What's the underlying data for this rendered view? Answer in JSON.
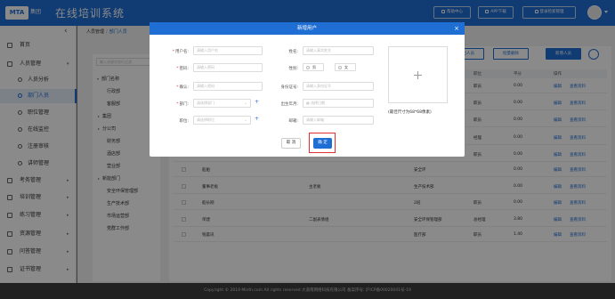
{
  "header": {
    "logo_text": "MTA",
    "logo_sub": "集团",
    "app_title": "在线培训系统",
    "buttons": [
      "帮助中心",
      "APP下载",
      "登录检索管理"
    ]
  },
  "sidebar": {
    "collapse_icon": "‹",
    "items": [
      {
        "label": "首页",
        "icon": "home-icon",
        "arrow": ""
      },
      {
        "label": "人员管理",
        "icon": "users-icon",
        "arrow": "▾"
      },
      {
        "label": "考务管理",
        "icon": "exam-icon",
        "arrow": "▸"
      },
      {
        "label": "培训管理",
        "icon": "training-icon",
        "arrow": "▸"
      },
      {
        "label": "练习管理",
        "icon": "practice-icon",
        "arrow": "▸"
      },
      {
        "label": "资源管理",
        "icon": "resource-icon",
        "arrow": "▸"
      },
      {
        "label": "问答管理",
        "icon": "qa-icon",
        "arrow": "▸"
      },
      {
        "label": "证书管理",
        "icon": "cert-icon",
        "arrow": "▸"
      }
    ],
    "sub_items": [
      "人员分析",
      "部门人员",
      "职位管理",
      "在线监控",
      "注册审核",
      "讲师管理"
    ],
    "active_sub": "部门人员"
  },
  "breadcrumb": {
    "root": "人员管理",
    "current": "部门人员"
  },
  "dept_tree": {
    "search_placeholder": "输入关键字进行过滤",
    "nodes": [
      {
        "label": "部门名称",
        "toggle": "▾",
        "indent": 0
      },
      {
        "label": "行政部",
        "toggle": "",
        "indent": 1
      },
      {
        "label": "客服部",
        "toggle": "",
        "indent": 1
      },
      {
        "label": "集团",
        "toggle": "▸",
        "indent": 1
      },
      {
        "label": "分公司",
        "toggle": "▸",
        "indent": 1
      },
      {
        "label": "财务部",
        "toggle": "",
        "indent": 1
      },
      {
        "label": "酒店部",
        "toggle": "",
        "indent": 1
      },
      {
        "label": "营业部",
        "toggle": "",
        "indent": 1
      },
      {
        "label": "新能部门",
        "toggle": "▸",
        "indent": 1
      },
      {
        "label": "安全环保管理部",
        "toggle": "",
        "indent": 1
      },
      {
        "label": "生产技术部",
        "toggle": "",
        "indent": 1
      },
      {
        "label": "市场运营部",
        "toggle": "",
        "indent": 1
      },
      {
        "label": "党群工作部",
        "toggle": "",
        "indent": 1
      }
    ]
  },
  "table": {
    "buttons": [
      "导出人员",
      "批量删除",
      "新增人员"
    ],
    "headers": [
      "职位",
      "平分",
      "操作"
    ],
    "rows": [
      {
        "c1": "",
        "c2": "",
        "c3": "",
        "status": "职员",
        "score": "0.00"
      },
      {
        "c1": "",
        "c2": "",
        "c3": "",
        "status": "职员",
        "score": "0.00"
      },
      {
        "c1": "",
        "c2": "",
        "c3": "",
        "status": "职员",
        "score": "0.00"
      },
      {
        "c1": "",
        "c2": "",
        "c3": "",
        "status": "经理",
        "score": "0.00"
      },
      {
        "c1": "",
        "c2": "",
        "c3": "",
        "status": "职员",
        "score": "0.00"
      },
      {
        "c1": "船舶",
        "c2": "",
        "c3": "安全环",
        "status": "",
        "score": "0.00"
      },
      {
        "c1": "董事老板",
        "c2": "主老板",
        "c3": "生产技术部",
        "status": "",
        "score": "0.00"
      },
      {
        "c1": "船长刚",
        "c2": "",
        "c3": "2班",
        "status": "职员",
        "score": "0.00"
      },
      {
        "c1": "单建",
        "c2": "二副表情组",
        "c3": "安全环保管理部",
        "status": "总经理",
        "score": "3.80"
      },
      {
        "c1": "钱晨讯",
        "c2": "",
        "c3": "医疗部",
        "status": "职员",
        "score": "1.40"
      }
    ],
    "edit_label": "编辑",
    "view_label": "查看资料"
  },
  "pager": {
    "total": "共 10 条",
    "page_size": "10条/页",
    "goto_label": "前往",
    "page": "1",
    "page_suffix": "页"
  },
  "footer": "Copyright © 2019 Minth.com All rights reserved 大道南网络科技有限公司 备案序号: 沪ICP备00020041号-19",
  "modal": {
    "title": "新增用户",
    "close": "×",
    "fields": {
      "username": {
        "label": "用户名:",
        "placeholder": "请输入用户名",
        "required": true
      },
      "name": {
        "label": "姓名:",
        "placeholder": "请输入真实姓名",
        "required": false
      },
      "password": {
        "label": "密码:",
        "placeholder": "请输入密码",
        "required": true
      },
      "gender": {
        "label": "性别:",
        "options": [
          "男",
          "女"
        ]
      },
      "confirm": {
        "label": "确认:",
        "placeholder": "请输入密码",
        "required": true
      },
      "id_card": {
        "label": "身份证号:",
        "placeholder": "请输入身份证号"
      },
      "dept": {
        "label": "部门:",
        "placeholder": "请选择部门",
        "required": true
      },
      "birth": {
        "label": "出生年月:",
        "placeholder": "选择日期"
      },
      "position": {
        "label": "职位:",
        "placeholder": "请选择职位",
        "required": false
      },
      "email": {
        "label": "邮箱:",
        "placeholder": "请输入邮箱"
      }
    },
    "upload_hint": "(最佳尺寸为68*68像素)",
    "cancel_label": "取 消",
    "ok_label": "确 定"
  }
}
